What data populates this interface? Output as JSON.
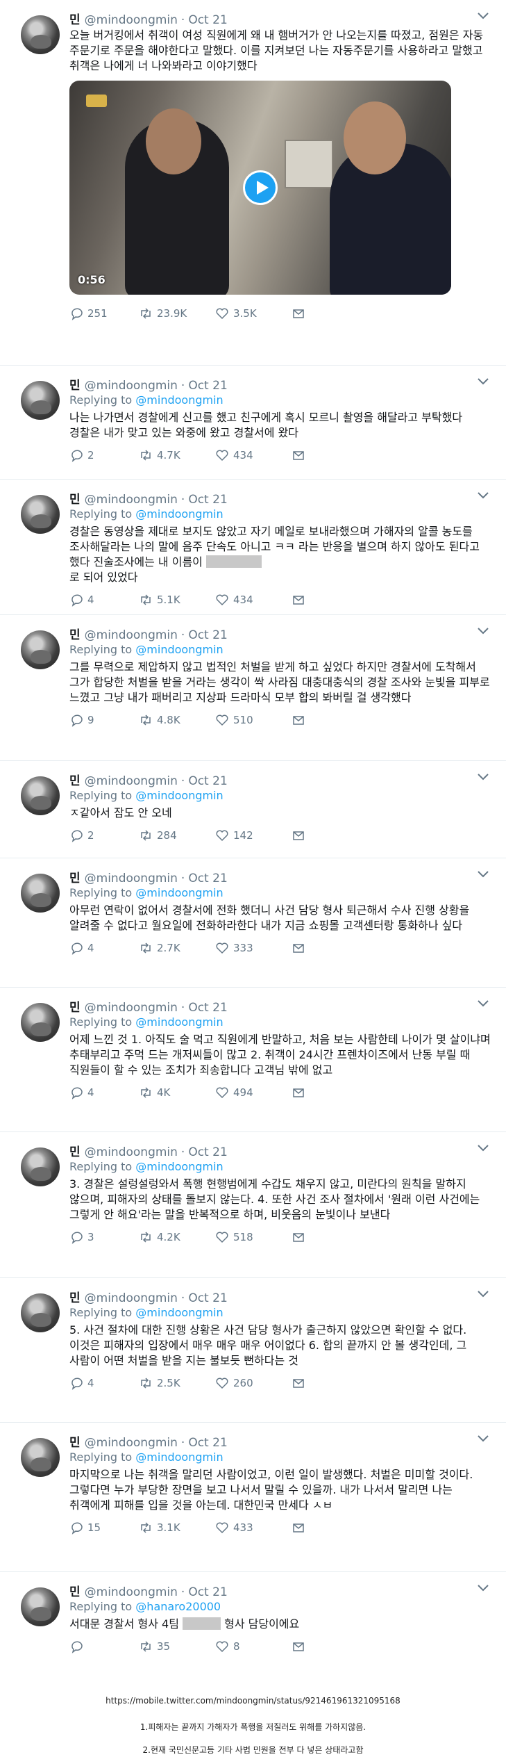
{
  "tweets": [
    {
      "name": "민",
      "handle": "@mindoongmin",
      "time": "Oct 21",
      "replying": "",
      "text": "오늘 버거킹에서 취객이 여성 직원에게 왜 내 햄버거가 안 나오는지를 따졌고, 점원은 자동 주문기로 주문을 해야한다고 말했다. 이를 지켜보던 나는 자동주문기를 사용하라고 말했고 취객은 나에게 너 나와봐라고 이야기했다",
      "video_time": "0:56",
      "replies": "251",
      "retweets": "23.9K",
      "likes": "3.5K"
    },
    {
      "name": "민",
      "handle": "@mindoongmin",
      "time": "Oct 21",
      "replying": "@mindoongmin",
      "text": "나는 나가면서 경찰에게 신고를 했고 친구에게 혹시 모르니 촬영을 해달라고 부탁했다 경찰은 내가 맞고 있는 와중에 왔고 경찰서에 왔다",
      "replies": "2",
      "retweets": "4.7K",
      "likes": "434"
    },
    {
      "name": "민",
      "handle": "@mindoongmin",
      "time": "Oct 21",
      "replying": "@mindoongmin",
      "text_a": "경찰은 동영상을 제대로 보지도 않았고 자기 메일로 보내라했으며 가해자의 알콜 농도를 조사해달라는 나의 말에 음주 단속도 아니고 ㅋㅋ 라는 반응을 별으며 하지 않아도 된다고 했다 진술조사에는 내 이름이 ",
      "text_b": "로 되어 있었다",
      "replies": "4",
      "retweets": "5.1K",
      "likes": "434"
    },
    {
      "name": "민",
      "handle": "@mindoongmin",
      "time": "Oct 21",
      "replying": "@mindoongmin",
      "text": "그를 무력으로 제압하지 않고 법적인 처벌을 받게 하고 싶었다 하지만 경찰서에 도착해서 그가 합당한 처벌을 받을 거라는 생각이 싹 사라짐 대충대충식의 경찰 조사와 눈빛을 피부로 느꼈고 그냥 내가 패버리고 지상파 드라마식 모부 합의 봐버릴 걸 생각했다",
      "replies": "9",
      "retweets": "4.8K",
      "likes": "510"
    },
    {
      "name": "민",
      "handle": "@mindoongmin",
      "time": "Oct 21",
      "replying": "@mindoongmin",
      "text": "ㅈ같아서 잠도 안 오네",
      "replies": "2",
      "retweets": "284",
      "likes": "142"
    },
    {
      "name": "민",
      "handle": "@mindoongmin",
      "time": "Oct 21",
      "replying": "@mindoongmin",
      "text": "아무런 연락이 없어서 경찰서에 전화 했더니 사건 담당 형사 퇴근해서 수사 진행 상황을 알려줄 수 없다고 월요일에 전화하라한다 내가 지금 쇼핑몰 고객센터랑 통화하나 싶다",
      "replies": "4",
      "retweets": "2.7K",
      "likes": "333"
    },
    {
      "name": "민",
      "handle": "@mindoongmin",
      "time": "Oct 21",
      "replying": "@mindoongmin",
      "text": "어제 느낀 것 1. 아직도 술 먹고 직원에게 반말하고, 처음 보는 사람한테 나이가 몇 살이냐며 추태부리고 주먹 드는 개저씨들이 많고 2. 취객이 24시간 프렌차이즈에서 난동 부릴 때 직원들이 할 수 있는 조치가 죄송합니다 고객님 밖에 없고",
      "replies": "4",
      "retweets": "4K",
      "likes": "494"
    },
    {
      "name": "민",
      "handle": "@mindoongmin",
      "time": "Oct 21",
      "replying": "@mindoongmin",
      "text": "3. 경찰은 설렁설렁와서 폭행 현행범에게 수갑도 채우지 않고, 미란다의 원칙을 말하지 않으며, 피해자의 상태를 돌보지 않는다. 4. 또한 사건 조사 절차에서 '원래 이런 사건에는 그렇게 안 해요'라는 말을 반복적으로 하며, 비웃음의 눈빛이나 보낸다",
      "replies": "3",
      "retweets": "4.2K",
      "likes": "518"
    },
    {
      "name": "민",
      "handle": "@mindoongmin",
      "time": "Oct 21",
      "replying": "@mindoongmin",
      "text": "5. 사건 절차에 대한 진행 상황은 사건 담당 형사가 출근하지 않았으면 확인할 수 없다. 이것은 피해자의 입장에서 매우 매우 매우 어이없다 6. 합의 끝까지 안 볼 생각인데, 그 사람이 어떤 처벌을 받을 지는 불보듯 뻔하다는 것",
      "replies": "4",
      "retweets": "2.5K",
      "likes": "260"
    },
    {
      "name": "민",
      "handle": "@mindoongmin",
      "time": "Oct 21",
      "replying": "@mindoongmin",
      "text": "마지막으로 나는 취객을 말리던 사람이었고, 이런 일이 발생했다. 처벌은 미미할 것이다. 그렇다면 누가 부당한 장면을 보고 나서서 말릴 수 있을까. 내가 나서서 말리면 나는 취객에게 피해를 입을 것을 아는데. 대한민국 만세다 ㅅㅂ",
      "replies": "15",
      "retweets": "3.1K",
      "likes": "433"
    },
    {
      "name": "민",
      "handle": "@mindoongmin",
      "time": "Oct 21",
      "replying": "@hanaro20000",
      "text_a": "서대문 경찰서 형사 4팀 ",
      "text_b": " 형사 담당이에요",
      "replies": "",
      "retweets": "35",
      "likes": "8"
    }
  ],
  "labels": {
    "replying_prefix": "Replying to "
  },
  "footer": {
    "url": "https://mobile.twitter.com/mindoongmin/status/921461961321095168",
    "note1": "1.피해자는 끝까지 가해자가 폭행을 저질러도 위해를 가하지않음.",
    "note2": "2.현재 국민신문고등 기타 사법 민원을 전부 다 넣은 상태라고함"
  },
  "colors": {
    "accent": "#1da1f2",
    "muted": "#657786",
    "text": "#14171a",
    "divider": "#e6ecf0"
  },
  "icons": [
    "reply-icon",
    "retweet-icon",
    "like-icon",
    "dm-icon",
    "chevron-down-icon",
    "play-icon"
  ]
}
